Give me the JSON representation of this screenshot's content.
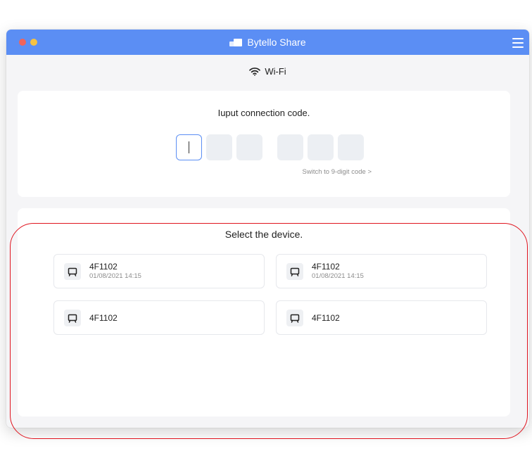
{
  "window": {
    "title": "Bytello Share",
    "icons": {
      "app_logo": "bytello-logo-icon",
      "menu": "hamburger-menu-icon"
    }
  },
  "network": {
    "label": "Wi-Fi",
    "icon": "wifi-icon"
  },
  "connection_code": {
    "prompt": "Iuput connection code.",
    "digit_slots": 6,
    "switch_link_label": "Switch to 9-digit code >"
  },
  "device_selection": {
    "title": "Select the device.",
    "devices": [
      {
        "name": "4F1102",
        "last_connected": "01/08/2021 14:15"
      },
      {
        "name": "4F1102",
        "last_connected": "01/08/2021 14:15"
      },
      {
        "name": "4F1102",
        "last_connected": ""
      },
      {
        "name": "4F1102",
        "last_connected": ""
      }
    ]
  },
  "colors": {
    "titlebar": "#5b8ef4",
    "close_button": "#f0645c",
    "minimize_button": "#f5c242",
    "annotation": "#e0141e"
  }
}
